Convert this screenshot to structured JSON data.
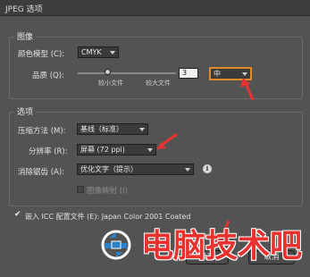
{
  "window": {
    "title": "JPEG 选项"
  },
  "image_section": {
    "legend": "图像",
    "color_model_label": "颜色模型 (C):",
    "color_model_value": "CMYK",
    "quality_label": "品质 (Q):",
    "quality_number": "3",
    "quality_value": "中",
    "quality_level": 0.3,
    "smaller_file": "较小文件",
    "larger_file": "较大文件"
  },
  "options_section": {
    "legend": "选项",
    "compression_label": "压缩方法 (M):",
    "compression_value": "基线（标准）",
    "resolution_label": "分辨率 (R):",
    "resolution_value": "屏幕 (72 ppi)",
    "antialias_label": "消除锯齿 (A):",
    "antialias_value": "优化文字（提示）",
    "imagemap_label": "图像映射 (I)",
    "imagemap_checked": false
  },
  "icc": {
    "label": "嵌入 ICC 配置文件 (E): Japan Color 2001 Coated",
    "checked": true
  },
  "buttons": {
    "ok": "确定",
    "cancel": "取消"
  },
  "watermark": {
    "text": "电脑技术吧"
  },
  "colors": {
    "arrow": "#e8322f",
    "watermark": "#e8322f",
    "highlight": "#e08a2a"
  }
}
